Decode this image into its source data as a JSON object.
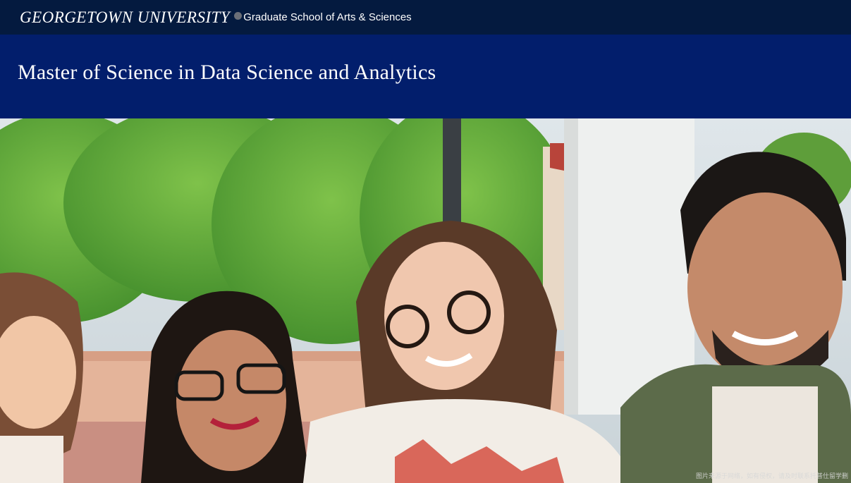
{
  "header": {
    "university_name": "GEORGETOWN UNIVERSITY",
    "school_name": "Graduate School of Arts & Sciences"
  },
  "banner": {
    "title": "Master of Science in Data Science and Analytics"
  },
  "hero": {
    "watermark": "图片来源于网络，如有侵权，请及时联系托普仕留学删"
  },
  "colors": {
    "top_bar": "#041a3f",
    "title_band": "#021e6c",
    "text": "#ffffff"
  }
}
